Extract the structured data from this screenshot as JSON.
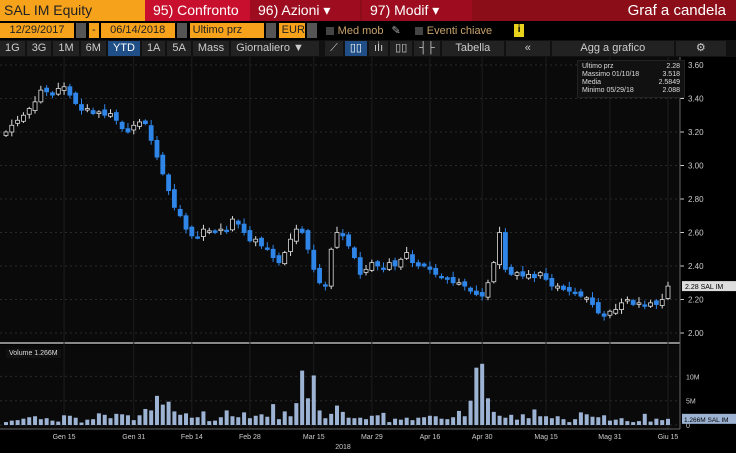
{
  "header": {
    "ticker": "SAL IM Equity",
    "menu": [
      "95) Confronto",
      "96) Azioni ▾",
      "97) Modif ▾"
    ],
    "title": "Graf a candela"
  },
  "controls": {
    "start_date": "12/29/2017",
    "dash": "-",
    "end_date": "06/14/2018",
    "field": "Ultimo prz",
    "currency": "EUR",
    "med_mob": "Med mob",
    "eventi": "Eventi chiave",
    "info": "i"
  },
  "toolbar": {
    "ranges": [
      "1G",
      "3G",
      "1M",
      "6M",
      "YTD",
      "1A",
      "5A",
      "Mass"
    ],
    "selected": "YTD",
    "period": "Giornaliero ▼",
    "tabella": "Tabella",
    "collapse": "«",
    "add": "Agg a grafico",
    "settings": "⚙"
  },
  "legend": {
    "rows": [
      [
        "Ultimo prz",
        "2.28"
      ],
      [
        "Massimo 01/10/18",
        "3.518"
      ],
      [
        "Media",
        "2.5849"
      ],
      [
        "Minimo 05/29/18",
        "2.088"
      ]
    ]
  },
  "volume_label": "Volume 1.266M",
  "chart_data": {
    "type": "candlestick",
    "title": "SAL IM Equity",
    "ylim": [
      2.0,
      3.6
    ],
    "yticks": [
      "2.00",
      "2.20",
      "2.40",
      "2.60",
      "2.80",
      "3.00",
      "3.20",
      "3.40",
      "3.60"
    ],
    "last_label": "2.28 SAL IM",
    "closes": [
      3.2,
      3.24,
      3.27,
      3.3,
      3.34,
      3.38,
      3.45,
      3.44,
      3.42,
      3.46,
      3.47,
      3.42,
      3.37,
      3.33,
      3.34,
      3.31,
      3.32,
      3.3,
      3.31,
      3.27,
      3.22,
      3.2,
      3.24,
      3.26,
      3.25,
      3.15,
      3.05,
      2.95,
      2.85,
      2.75,
      2.7,
      2.62,
      2.58,
      2.57,
      2.62,
      2.61,
      2.6,
      2.62,
      2.61,
      2.68,
      2.65,
      2.6,
      2.55,
      2.56,
      2.52,
      2.5,
      2.45,
      2.42,
      2.48,
      2.56,
      2.62,
      2.6,
      2.5,
      2.38,
      2.3,
      2.28,
      2.5,
      2.6,
      2.58,
      2.52,
      2.45,
      2.35,
      2.38,
      2.42,
      2.4,
      2.38,
      2.42,
      2.4,
      2.44,
      2.48,
      2.42,
      2.4,
      2.4,
      2.38,
      2.35,
      2.33,
      2.32,
      2.3,
      2.3,
      2.28,
      2.25,
      2.23,
      2.22,
      2.3,
      2.42,
      2.6,
      2.38,
      2.35,
      2.36,
      2.34,
      2.35,
      2.33,
      2.36,
      2.32,
      2.28,
      2.28,
      2.26,
      2.25,
      2.24,
      2.22,
      2.21,
      2.17,
      2.12,
      2.1,
      2.13,
      2.14,
      2.18,
      2.2,
      2.17,
      2.18,
      2.16,
      2.18,
      2.17,
      2.2,
      2.28
    ],
    "volume": {
      "ylim": [
        0,
        14
      ],
      "yticks": [
        "0",
        "5M",
        "10M"
      ],
      "last_label": "1.266M SAL IM",
      "values": [
        0.6,
        0.9,
        1.0,
        1.3,
        1.6,
        1.8,
        1.2,
        1.4,
        0.9,
        0.7,
        2.0,
        1.9,
        1.5,
        0.5,
        1.1,
        1.2,
        2.4,
        2.1,
        1.4,
        2.3,
        2.2,
        2.0,
        1.0,
        2.0,
        3.3,
        3.0,
        6.0,
        4.2,
        4.8,
        2.8,
        2.1,
        2.4,
        1.5,
        1.6,
        2.8,
        0.8,
        0.9,
        1.6,
        3.0,
        1.8,
        1.6,
        2.6,
        1.4,
        1.9,
        2.2,
        1.7,
        4.3,
        1.2,
        2.8,
        1.8,
        4.5,
        11.2,
        5.5,
        10.2,
        3.0,
        1.4,
        2.3,
        4.0,
        2.7,
        1.5,
        1.4,
        1.5,
        1.2,
        1.9,
        2.0,
        2.5,
        0.6,
        1.3,
        1.1,
        1.5,
        1.0,
        1.5,
        1.6,
        1.9,
        1.8,
        1.3,
        1.2,
        1.6,
        2.9,
        1.8,
        5.0,
        11.8,
        12.6,
        5.5,
        2.7,
        1.9,
        1.5,
        2.1,
        1.1,
        2.2,
        1.4,
        3.2,
        1.8,
        1.8,
        1.4,
        1.8,
        1.2,
        0.6,
        1.2,
        2.6,
        2.2,
        1.7,
        1.6,
        2.0,
        0.9,
        1.1,
        1.4,
        0.8,
        0.6,
        0.8,
        2.3,
        0.7,
        1.3,
        1.0,
        1.27
      ]
    },
    "xticks": [
      {
        "label": "Gen 15",
        "index": 10
      },
      {
        "label": "Gen 31",
        "index": 22
      },
      {
        "label": "Feb 14",
        "index": 32
      },
      {
        "label": "Feb 28",
        "index": 42
      },
      {
        "label": "Mar 15",
        "index": 53
      },
      {
        "label": "Mar 29",
        "index": 63
      },
      {
        "label": "Apr 16",
        "index": 73
      },
      {
        "label": "Apr 30",
        "index": 82
      },
      {
        "label": "Mag 15",
        "index": 93
      },
      {
        "label": "Mag 31",
        "index": 104
      },
      {
        "label": "Giu 15",
        "index": 114
      }
    ],
    "xlabel": "2018"
  }
}
